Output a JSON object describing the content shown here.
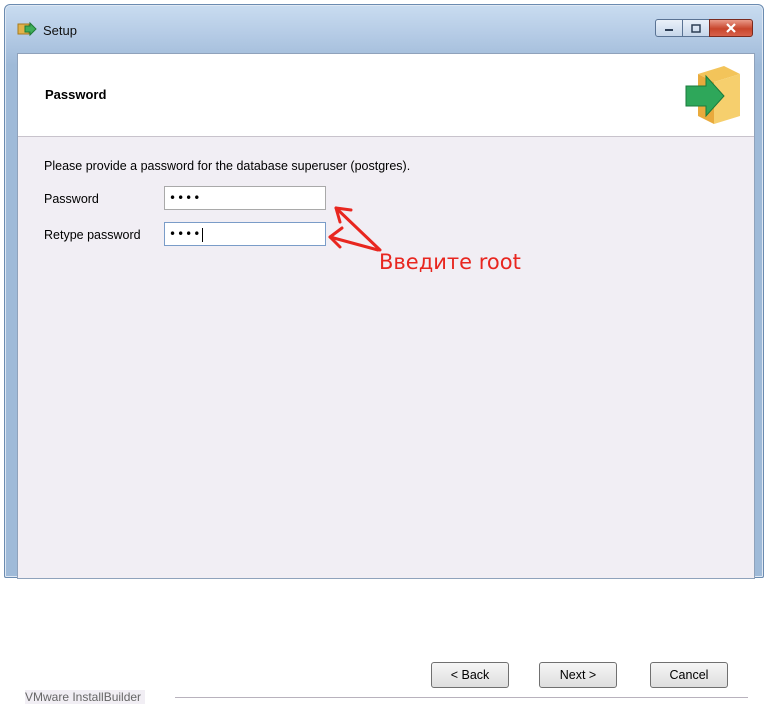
{
  "window": {
    "title": "Setup",
    "icon": "setup-arrow-icon"
  },
  "header": {
    "title": "Password",
    "icon": "installer-box-arrow-icon"
  },
  "form": {
    "description": "Please provide a password for the database superuser (postgres).",
    "password_label": "Password",
    "password_value": "••••",
    "retype_label": "Retype password",
    "retype_value": "••••"
  },
  "annotation": {
    "text": "Введите root",
    "color": "#e8261f"
  },
  "footer": {
    "brand": "VMware InstallBuilder",
    "back_label": "< Back",
    "next_label": "Next >",
    "cancel_label": "Cancel"
  }
}
